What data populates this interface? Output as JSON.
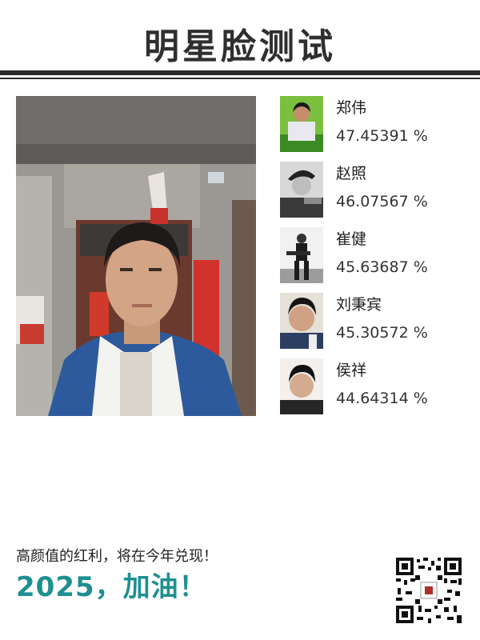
{
  "title": "明星脸测试",
  "matches": [
    {
      "name": "郑伟",
      "score": "47.45391 %"
    },
    {
      "name": "赵照",
      "score": "46.07567 %"
    },
    {
      "name": "崔健",
      "score": "45.63687 %"
    },
    {
      "name": "刘秉宾",
      "score": "45.30572 %"
    },
    {
      "name": "侯祥",
      "score": "44.64314 %"
    }
  ],
  "footer": {
    "slogan": "高颜值的红利，将在今年兑现！",
    "cheer": "2025，加油！"
  },
  "colors": {
    "title": "#2f2f2f",
    "cheer": "#1f8f91",
    "rule": "#2b2b2b"
  }
}
